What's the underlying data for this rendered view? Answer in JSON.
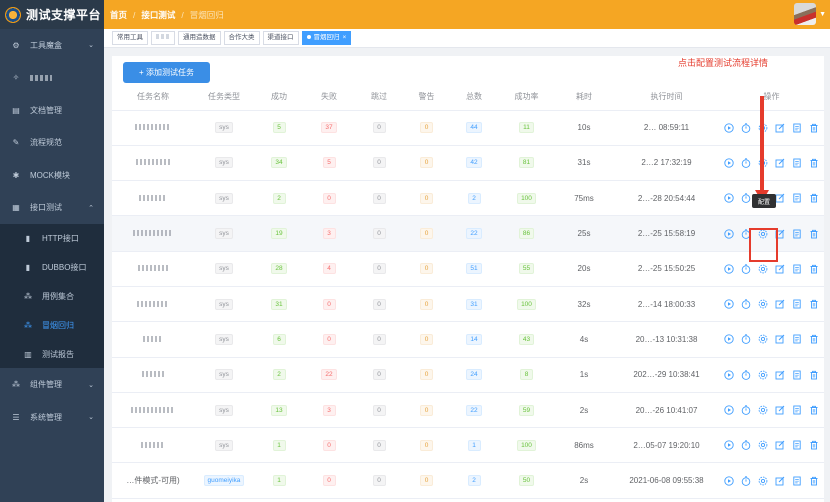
{
  "app": {
    "title": "测试支撑平台"
  },
  "breadcrumb": [
    "首页",
    "接口测试",
    "冒烟回归"
  ],
  "sidebar": {
    "items": [
      {
        "label": "工具魔盒",
        "icon": "gear-icon",
        "chevron": true
      },
      {
        "label": "",
        "icon": "magic-icon",
        "chevron": false,
        "redacted": true
      },
      {
        "label": "文档管理",
        "icon": "document-icon",
        "chevron": false
      },
      {
        "label": "流程规范",
        "icon": "edit-icon",
        "chevron": false
      },
      {
        "label": "MOCK模块",
        "icon": "bug-icon",
        "chevron": false
      },
      {
        "label": "接口测试",
        "icon": "grid-icon",
        "chevron": true,
        "expanded": true
      }
    ],
    "subitems": [
      {
        "label": "HTTP接口",
        "icon": "component-icon",
        "active": false
      },
      {
        "label": "DUBBO接口",
        "icon": "component-icon",
        "active": false
      },
      {
        "label": "用例集合",
        "icon": "tree-icon",
        "active": false
      },
      {
        "label": "冒烟回归",
        "icon": "tree-icon",
        "active": true
      },
      {
        "label": "测试报告",
        "icon": "chart-icon",
        "active": false
      }
    ],
    "bottom": [
      {
        "label": "组件管理",
        "icon": "tree-icon",
        "chevron": true
      },
      {
        "label": "系统管理",
        "icon": "list-icon",
        "chevron": true
      }
    ]
  },
  "tags_view": [
    {
      "label": "常用工具",
      "active": false
    },
    {
      "label": "",
      "active": false,
      "redacted": true
    },
    {
      "label": "通用造数据",
      "active": false
    },
    {
      "label": "合作大类",
      "active": false
    },
    {
      "label": "渠道接口",
      "active": false
    },
    {
      "label": "冒烟回归",
      "active": true,
      "close": "×"
    }
  ],
  "toolbar": {
    "add_label": "+ 添加测试任务"
  },
  "annotation": {
    "text": "点击配置测试流程详情",
    "tooltip": "配置"
  },
  "table": {
    "headers": [
      "任务名称",
      "任务类型",
      "成功",
      "失败",
      "跳过",
      "警告",
      "总数",
      "成功率",
      "耗时",
      "执行时间",
      "操作"
    ],
    "rows": [
      {
        "name": "",
        "type": "sys",
        "succ": "5",
        "fail": "37",
        "skip": "0",
        "warn": "0",
        "total": "44",
        "rate": "11",
        "time": "10s",
        "exec": "2… 08:59:11"
      },
      {
        "name": "",
        "type": "sys",
        "succ": "34",
        "fail": "5",
        "skip": "0",
        "warn": "0",
        "total": "42",
        "rate": "81",
        "time": "31s",
        "exec": "2…2 17:32:19"
      },
      {
        "name": "",
        "type": "sys",
        "succ": "2",
        "fail": "0",
        "skip": "0",
        "warn": "0",
        "total": "2",
        "rate": "100",
        "time": "75ms",
        "exec": "2…-28 20:54:44"
      },
      {
        "name": "",
        "type": "sys",
        "succ": "19",
        "fail": "3",
        "skip": "0",
        "warn": "0",
        "total": "22",
        "rate": "86",
        "time": "25s",
        "exec": "2…-25 15:58:19"
      },
      {
        "name": "",
        "type": "sys",
        "succ": "28",
        "fail": "4",
        "skip": "0",
        "warn": "0",
        "total": "51",
        "rate": "55",
        "time": "20s",
        "exec": "2…-25 15:50:25"
      },
      {
        "name": "",
        "type": "sys",
        "succ": "31",
        "fail": "0",
        "skip": "0",
        "warn": "0",
        "total": "31",
        "rate": "100",
        "time": "32s",
        "exec": "2…-14 18:00:33"
      },
      {
        "name": "",
        "type": "sys",
        "succ": "6",
        "fail": "0",
        "skip": "0",
        "warn": "0",
        "total": "14",
        "rate": "43",
        "time": "4s",
        "exec": "20…-13 10:31:38"
      },
      {
        "name": "",
        "type": "sys",
        "succ": "2",
        "fail": "22",
        "skip": "0",
        "warn": "0",
        "total": "24",
        "rate": "8",
        "time": "1s",
        "exec": "202…-29 10:38:41"
      },
      {
        "name": "",
        "type": "sys",
        "succ": "13",
        "fail": "3",
        "skip": "0",
        "warn": "0",
        "total": "22",
        "rate": "59",
        "time": "2s",
        "exec": "20…-26 10:41:07"
      },
      {
        "name": "",
        "type": "sys",
        "succ": "1",
        "fail": "0",
        "skip": "0",
        "warn": "0",
        "total": "1",
        "rate": "100",
        "time": "86ms",
        "exec": "2…05-07 19:20:10"
      },
      {
        "name": "…件模式-可用)",
        "type": "guomeiyika",
        "succ": "1",
        "fail": "0",
        "skip": "0",
        "warn": "0",
        "total": "2",
        "rate": "50",
        "time": "2s",
        "exec": "2021-06-08 09:55:38"
      }
    ]
  }
}
